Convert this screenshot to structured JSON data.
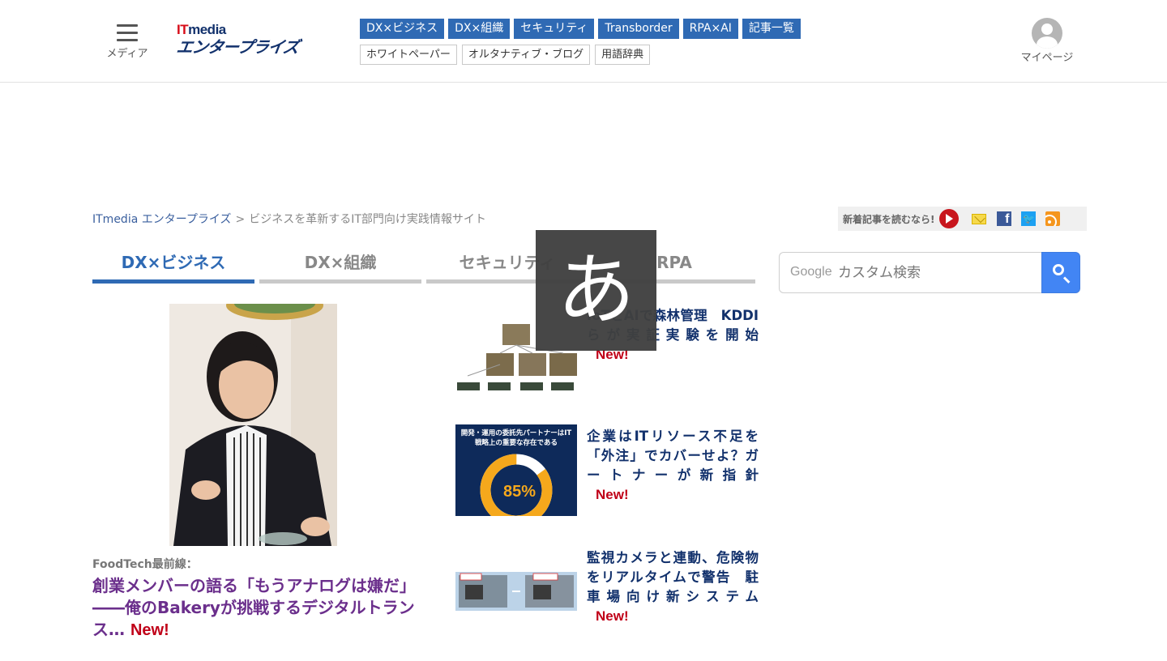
{
  "header": {
    "menu_label": "メディア",
    "logo_top_it": "IT",
    "logo_top_media": "media",
    "logo_bottom": "エンタープライズ",
    "nav_primary": [
      "DX×ビジネス",
      "DX×組織",
      "セキュリティ",
      "Transborder",
      "RPA×AI",
      "記事一覧"
    ],
    "nav_secondary": [
      "ホワイトペーパー",
      "オルタナティブ・ブログ",
      "用語辞典"
    ],
    "mypage_label": "マイページ"
  },
  "breadcrumb": {
    "home": "ITmedia エンタープライズ",
    "separator": ">",
    "current": "ビジネスを革新するIT部門向け実践情報サイト"
  },
  "new_articles": {
    "label": "新着記事を読むなら!"
  },
  "tabs": [
    "DX×ビジネス",
    "DX×組織",
    "セキュリティ",
    "RPA"
  ],
  "search": {
    "brand": "Google",
    "placeholder": "カスタム検索"
  },
  "main_article": {
    "label": "FoodTech最前線：",
    "title": "創業メンバーの語る「もうアナログは嫌だ」――俺のBakeryが挑戦するデジタルトランス…",
    "badge": "New!"
  },
  "side_articles": [
    {
      "title": "IoTとAIで森林管理　KDDIらが実証実験を開始",
      "badge": "New!"
    },
    {
      "title": "企業はITリソース不足を「外注」でカバーせよ？ガートナーが新指針",
      "badge": "New!",
      "thumb_text": "開発・運用の委託先パートナーはIT戦略上の重要な存在である",
      "thumb_value": "85%",
      "thumb_fraction": 0.85
    },
    {
      "title": "監視カメラと連動、危険物をリアルタイムで警告　駐車場向け新システム",
      "badge": "New!"
    }
  ],
  "ime_indicator": "あ",
  "colors": {
    "brand_blue": "#2f6ab4",
    "title_navy": "#12316c",
    "visited_purple": "#6b2f8c",
    "new_red": "#c00018"
  }
}
